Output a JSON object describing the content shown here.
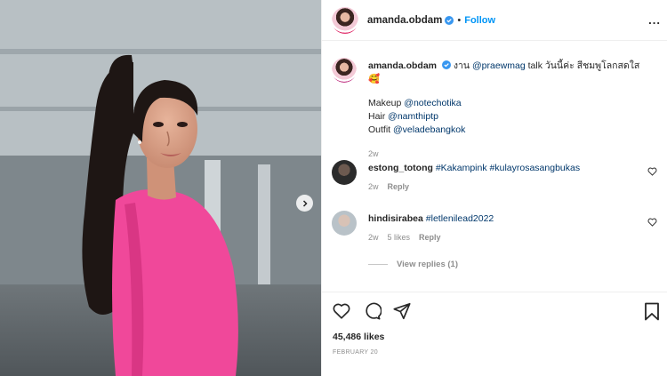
{
  "post": {
    "username": "amanda.obdam",
    "follow_label": "Follow",
    "separator": "•",
    "more_label": "..."
  },
  "caption": {
    "username": "amanda.obdam",
    "prefix": "งาน ",
    "mention": "@praewmag",
    "text": " talk วันนี้ค่ะ สีชมพูโลกสดใส ",
    "emoji": "🥰",
    "credits": [
      {
        "role": "Makeup ",
        "handle": "@notechotika"
      },
      {
        "role": "Hair ",
        "handle": "@namthiptp"
      },
      {
        "role": "Outfit ",
        "handle": "@veladebangkok"
      }
    ],
    "time": "2w"
  },
  "comments": [
    {
      "username": "estong_totong",
      "text": "#Kakampink #kulayrosasangbukas",
      "time": "2w",
      "likes": "",
      "reply_label": "Reply"
    },
    {
      "username": "hindisirabea",
      "text": "#letlenilead2022",
      "time": "2w",
      "likes": "5 likes",
      "reply_label": "Reply"
    }
  ],
  "view_replies": "View replies (1)",
  "footer": {
    "likes": "45,486 likes",
    "date": "FEBRUARY 20"
  },
  "colors": {
    "link": "#0095f6",
    "mention": "#00376b",
    "muted": "#8e8e8e",
    "dress": "#f0489a"
  }
}
